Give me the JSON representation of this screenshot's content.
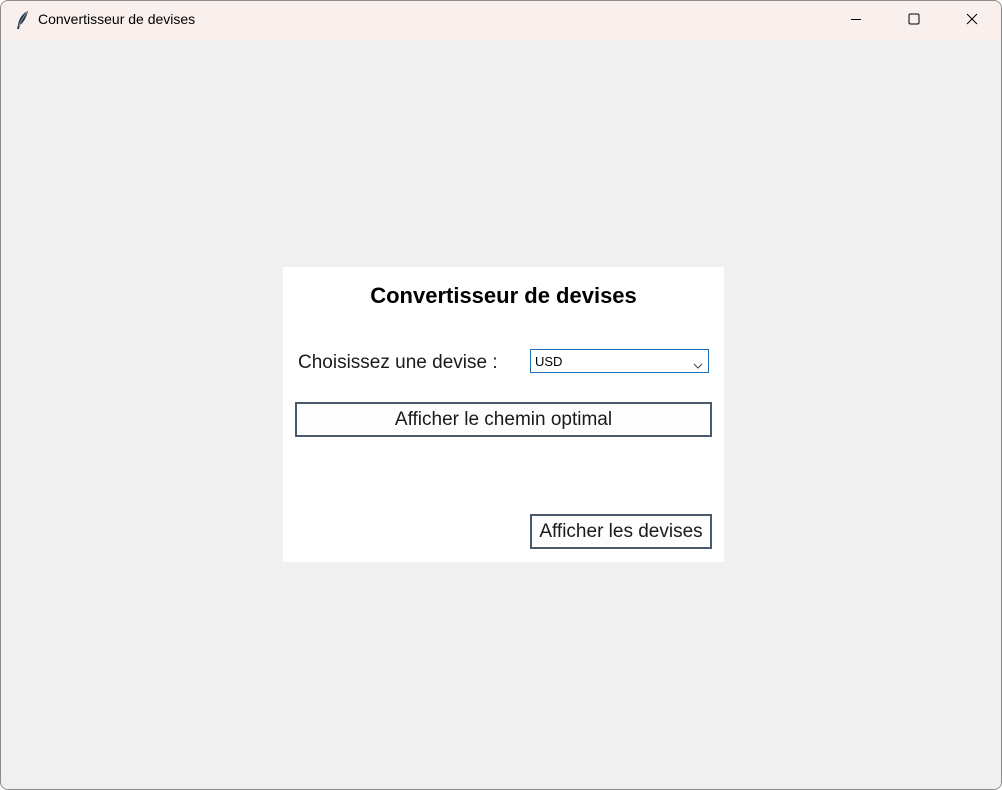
{
  "window": {
    "title": "Convertisseur de devises",
    "icon": "feather-icon"
  },
  "titlebar_controls": {
    "minimize_icon": "minimize-icon",
    "maximize_icon": "maximize-icon",
    "close_icon": "close-icon"
  },
  "panel": {
    "heading": "Convertisseur de devises",
    "currency_label": "Choisissez une devise :",
    "currency_select": {
      "selected": "USD"
    },
    "optimal_path_button": "Afficher le chemin optimal",
    "show_currencies_button": "Afficher les devises"
  },
  "colors": {
    "titlebar_bg": "#f9efec",
    "client_bg": "#f0f0f0",
    "panel_bg": "#ffffff",
    "combo_border": "#1f6fb8"
  }
}
